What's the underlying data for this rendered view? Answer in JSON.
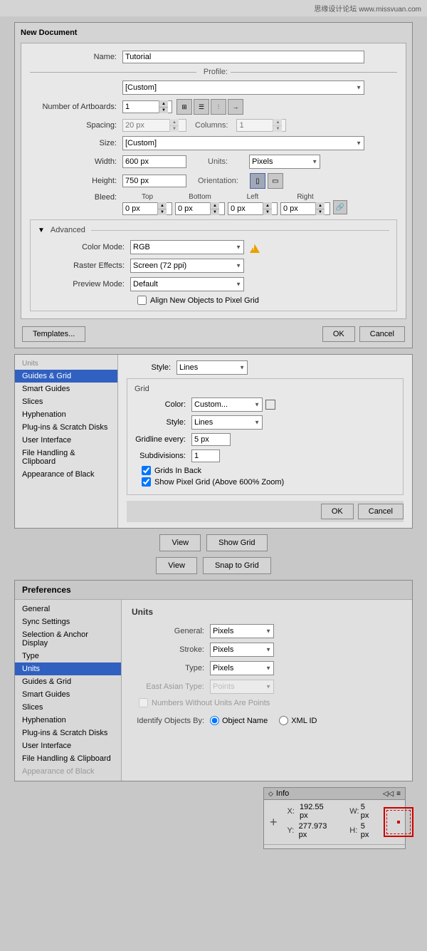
{
  "watermark": {
    "text": "思缘设计论坛  www.missvuan.com"
  },
  "new_document_dialog": {
    "title": "New Document",
    "name_label": "Name:",
    "name_value": "Tutorial",
    "profile_label": "Profile:",
    "profile_value": "[Custom]",
    "artboards_label": "Number of Artboards:",
    "artboards_value": "1",
    "spacing_label": "Spacing:",
    "spacing_value": "20 px",
    "columns_label": "Columns:",
    "columns_value": "1",
    "size_label": "Size:",
    "size_value": "[Custom]",
    "width_label": "Width:",
    "width_value": "600 px",
    "units_label": "Units:",
    "units_value": "Pixels",
    "height_label": "Height:",
    "height_value": "750 px",
    "orientation_label": "Orientation:",
    "bleed_label": "Bleed:",
    "bleed_top_label": "Top",
    "bleed_top_value": "0 px",
    "bleed_bottom_label": "Bottom",
    "bleed_bottom_value": "0 px",
    "bleed_left_label": "Left",
    "bleed_left_value": "0 px",
    "bleed_right_label": "Right",
    "bleed_right_value": "0 px",
    "advanced_label": "Advanced",
    "color_mode_label": "Color Mode:",
    "color_mode_value": "RGB",
    "raster_effects_label": "Raster Effects:",
    "raster_effects_value": "Screen (72 ppi)",
    "preview_mode_label": "Preview Mode:",
    "preview_mode_value": "Default",
    "align_pixel_label": "Align New Objects to Pixel Grid",
    "templates_btn": "Templates...",
    "ok_btn": "OK",
    "cancel_btn": "Cancel"
  },
  "grid_prefs": {
    "title": "Units",
    "guides_section": {
      "style_label": "Style:",
      "style_value": "Lines",
      "grid_title": "Grid",
      "color_label": "Color:",
      "color_value": "Custom...",
      "grid_style_label": "Style:",
      "grid_style_value": "Lines",
      "gridline_label": "Gridline every:",
      "gridline_value": "5 px",
      "subdivisions_label": "Subdivisions:",
      "subdivisions_value": "1",
      "grids_in_back": "Grids In Back",
      "show_pixel_grid": "Show Pixel Grid (Above 600% Zoom)"
    },
    "ok_btn": "OK",
    "cancel_btn": "Cancel",
    "sidebar_items": [
      {
        "label": "Guides & Grid",
        "active": true
      },
      {
        "label": "Smart Guides"
      },
      {
        "label": "Slices"
      },
      {
        "label": "Hyphenation"
      },
      {
        "label": "Plug-ins & Scratch Disks"
      },
      {
        "label": "User Interface"
      },
      {
        "label": "File Handling & Clipboard"
      },
      {
        "label": "Appearance of Black"
      }
    ]
  },
  "button_rows": [
    {
      "left_btn": "View",
      "right_btn": "Show Grid"
    },
    {
      "left_btn": "View",
      "right_btn": "Snap to Grid"
    }
  ],
  "preferences_dialog": {
    "title": "Preferences",
    "sidebar_items": [
      {
        "label": "General"
      },
      {
        "label": "Sync Settings"
      },
      {
        "label": "Selection & Anchor Display"
      },
      {
        "label": "Type"
      },
      {
        "label": "Units",
        "active": true
      },
      {
        "label": "Guides & Grid"
      },
      {
        "label": "Smart Guides"
      },
      {
        "label": "Slices"
      },
      {
        "label": "Hyphenation"
      },
      {
        "label": "Plug-ins & Scratch Disks"
      },
      {
        "label": "User Interface"
      },
      {
        "label": "File Handling & Clipboard"
      },
      {
        "label": "Appearance of Black",
        "disabled": true
      }
    ],
    "units_section": {
      "title": "Units",
      "general_label": "General:",
      "general_value": "Pixels",
      "stroke_label": "Stroke:",
      "stroke_value": "Pixels",
      "type_label": "Type:",
      "type_value": "Pixels",
      "east_asian_label": "East Asian Type:",
      "east_asian_value": "Points",
      "east_asian_disabled": true,
      "numbers_label": "Numbers Without Units Are Points",
      "numbers_disabled": true,
      "identify_label": "Identify Objects By:",
      "object_name_label": "Object Name",
      "xml_id_label": "XML ID"
    }
  },
  "info_panel": {
    "title": "Info",
    "expand_icon": "◁◁",
    "menu_icon": "≡",
    "x_label": "X:",
    "x_value": "192.55 px",
    "y_label": "Y:",
    "y_value": "277.973 px",
    "w_label": "W:",
    "w_value": "5 px",
    "h_label": "H:",
    "h_value": "5 px"
  }
}
